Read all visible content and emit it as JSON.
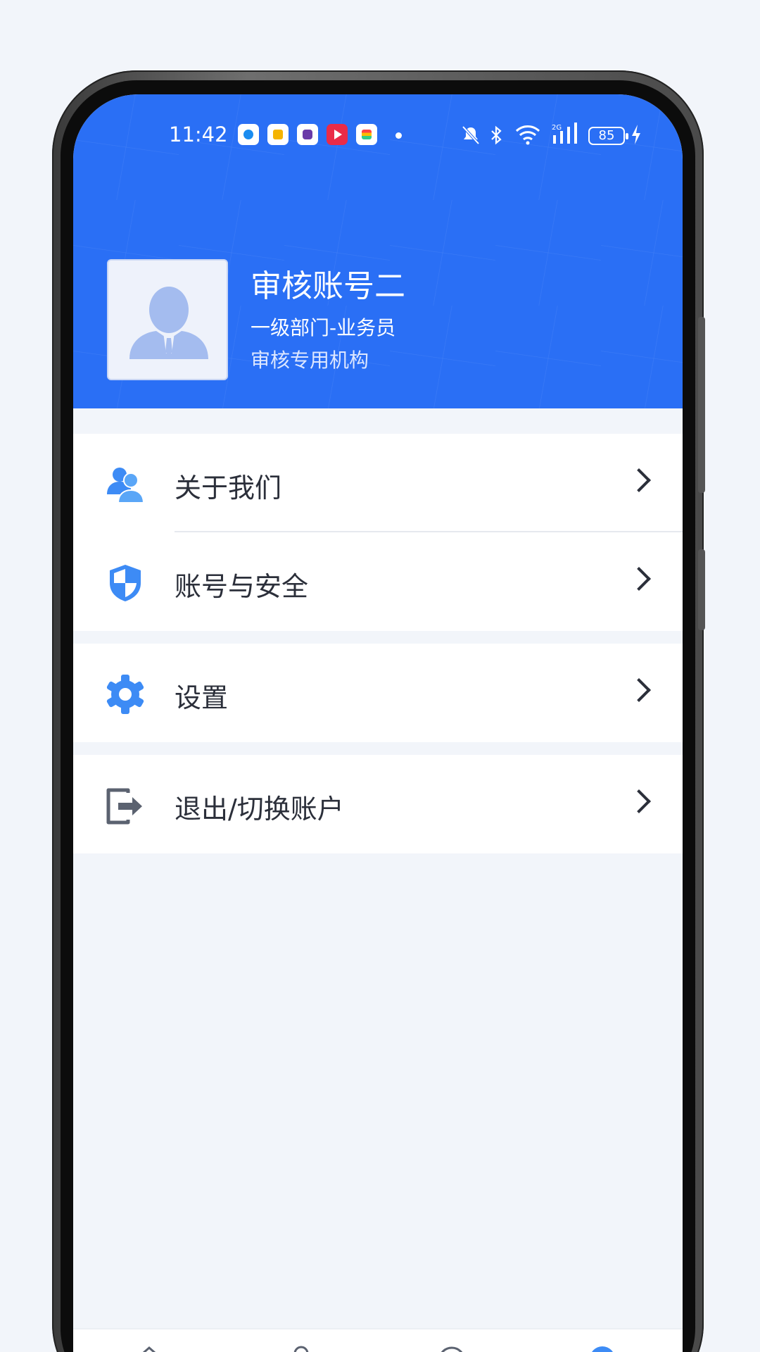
{
  "status_bar": {
    "time": "11:42",
    "battery": "85",
    "notification_icons": [
      "app-icon-1",
      "app-icon-2",
      "app-icon-3",
      "video-app-icon",
      "wallet-app-icon"
    ],
    "system_icons": [
      "mute-bell-icon",
      "bluetooth-icon",
      "wifi-icon",
      "signal-2g-icon",
      "battery-icon",
      "charging-icon"
    ]
  },
  "profile": {
    "name": "审核账号二",
    "role": "一级部门-业务员",
    "org": "审核专用机构"
  },
  "menu": {
    "about_label": "关于我们",
    "security_label": "账号与安全",
    "settings_label": "设置",
    "logout_label": "退出/切换账户"
  },
  "colors": {
    "header_bg": "#2a6ff5",
    "accent": "#3d8bf5",
    "page_bg": "#f2f5fa",
    "text": "#2b2f3a"
  },
  "bottom_nav": {
    "items": [
      "home-icon",
      "user-icon",
      "message-icon",
      "profile-active-icon"
    ]
  }
}
